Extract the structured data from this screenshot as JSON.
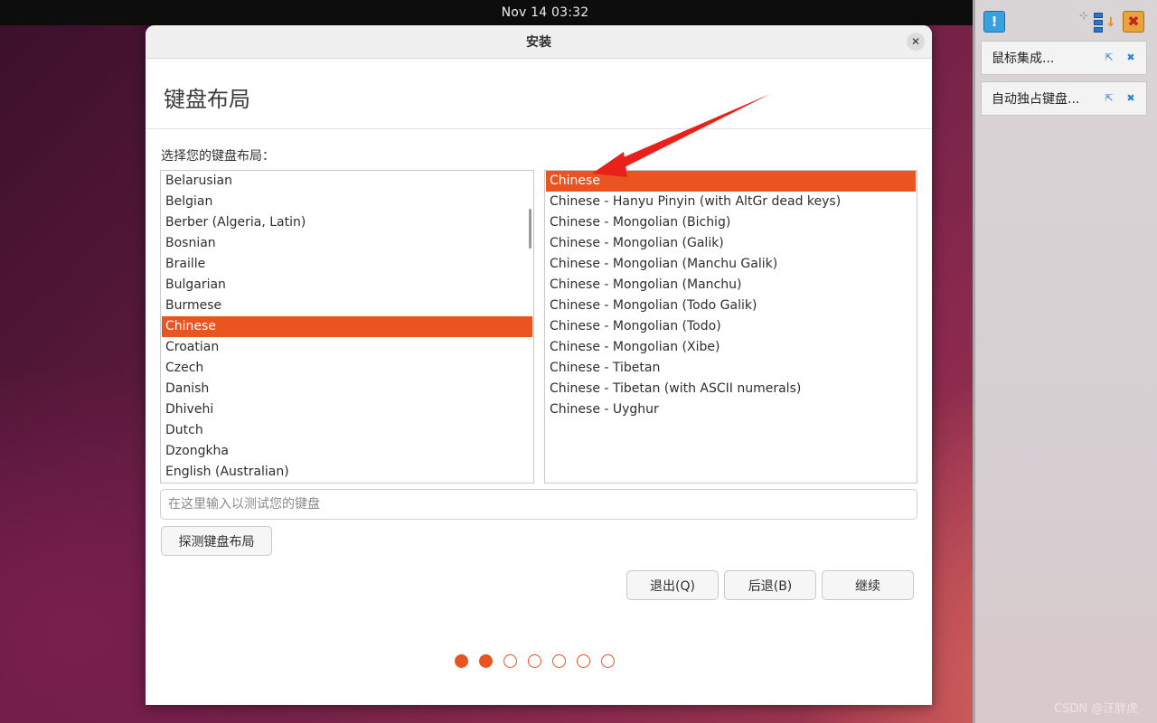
{
  "topbar": {
    "clock": "Nov 14  03:32"
  },
  "side_panel": {
    "notices": [
      {
        "label": "鼠标集成..."
      },
      {
        "label": "自动独占键盘..."
      }
    ]
  },
  "window": {
    "title": "安装",
    "page_title": "键盘布局",
    "prompt": "选择您的键盘布局：",
    "layouts": [
      "Belarusian",
      "Belgian",
      "Berber (Algeria, Latin)",
      "Bosnian",
      "Braille",
      "Bulgarian",
      "Burmese",
      "Chinese",
      "Croatian",
      "Czech",
      "Danish",
      "Dhivehi",
      "Dutch",
      "Dzongkha",
      "English (Australian)"
    ],
    "selected_layout": "Chinese",
    "variants": [
      "Chinese",
      "Chinese - Hanyu Pinyin (with AltGr dead keys)",
      "Chinese - Mongolian (Bichig)",
      "Chinese - Mongolian (Galik)",
      "Chinese - Mongolian (Manchu Galik)",
      "Chinese - Mongolian (Manchu)",
      "Chinese - Mongolian (Todo Galik)",
      "Chinese - Mongolian (Todo)",
      "Chinese - Mongolian (Xibe)",
      "Chinese - Tibetan",
      "Chinese - Tibetan (with ASCII numerals)",
      "Chinese - Uyghur"
    ],
    "selected_variant": "Chinese",
    "test_placeholder": "在这里输入以测试您的键盘",
    "detect_label": "探测键盘布局",
    "quit_label": "退出(Q)",
    "back_label": "后退(B)",
    "continue_label": "继续",
    "progress": {
      "total_steps": 7,
      "completed_steps": 2
    }
  },
  "watermark": "CSDN @汪胖虎",
  "colors": {
    "accent": "#e95420",
    "annotation_arrow": "#e8221b"
  }
}
